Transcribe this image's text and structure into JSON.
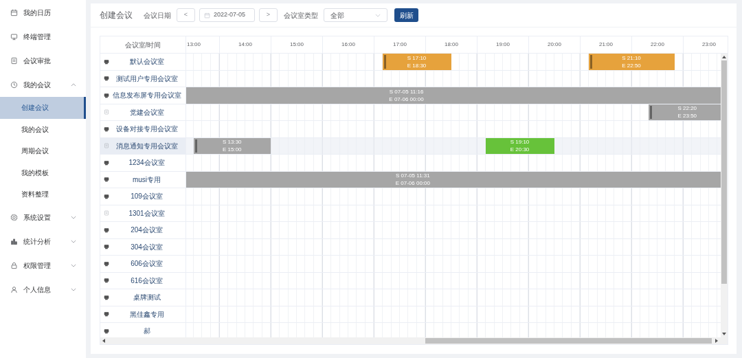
{
  "sidebar": {
    "items": [
      {
        "label": "我的日历",
        "selected": false
      },
      {
        "label": "终端管理",
        "selected": false
      },
      {
        "label": "会议审批",
        "selected": false
      },
      {
        "label": "我的会议",
        "selected": false,
        "expanded": true,
        "children": [
          {
            "label": "创建会议",
            "selected": true
          },
          {
            "label": "我的会议",
            "selected": false
          },
          {
            "label": "周期会议",
            "selected": false
          },
          {
            "label": "我的模板",
            "selected": false
          },
          {
            "label": "资料整理",
            "selected": false
          }
        ]
      },
      {
        "label": "系统设置",
        "selected": false,
        "expanded": false
      },
      {
        "label": "统计分析",
        "selected": false,
        "expanded": false
      },
      {
        "label": "权限管理",
        "selected": false,
        "expanded": false
      },
      {
        "label": "个人信息",
        "selected": false,
        "expanded": false
      }
    ]
  },
  "toolbar": {
    "title": "创建会议",
    "date_label": "会议日期",
    "prev": "<",
    "date": "2022-07-05",
    "next": ">",
    "type_label": "会议室类型",
    "type_value": "全部",
    "refresh": "刷新"
  },
  "table": {
    "corner": "会议室/时间",
    "hours": [
      "13:00",
      "14:00",
      "15:00",
      "16:00",
      "17:00",
      "18:00",
      "19:00",
      "20:00",
      "21:00",
      "22:00",
      "23:00"
    ],
    "rows": [
      {
        "room": "默认会议室",
        "kind": "monitor",
        "highlighted": false,
        "events": [
          {
            "color": "#e6a23c",
            "marker": true,
            "lines": [
              "S 17:10",
              "E 18:30"
            ]
          },
          {
            "color": "#e6a23c",
            "marker": true,
            "lines": [
              "S 21:10",
              "E 22:50"
            ]
          }
        ]
      },
      {
        "room": "测试用户专用会议室",
        "kind": "monitor",
        "highlighted": false
      },
      {
        "room": "信息发布屏专用会议室",
        "kind": "monitor",
        "highlighted": false,
        "events": [
          {
            "color": "#a6a6a6",
            "marker": false,
            "lines": [
              "S 07-05 11:16",
              "E 07-06 00:00"
            ]
          }
        ]
      },
      {
        "room": "党建会议室",
        "kind": "document",
        "highlighted": false,
        "events": [
          {
            "color": "#a6a6a6",
            "marker": true,
            "lines": [
              "S 22:20",
              "E 23:50"
            ]
          }
        ]
      },
      {
        "room": "设备对接专用会议室",
        "kind": "monitor",
        "highlighted": false
      },
      {
        "room": "消息通知专用会议室",
        "kind": "document",
        "highlighted": true,
        "events": [
          {
            "color": "#a6a6a6",
            "marker": true,
            "lines": [
              "S 13:30",
              "E 15:00"
            ]
          },
          {
            "color": "#67c23a",
            "marker": false,
            "lines": [
              "S 19:10",
              "E 20:30"
            ]
          }
        ]
      },
      {
        "room": "1234会议室",
        "kind": "monitor",
        "highlighted": false
      },
      {
        "room": "musi专用",
        "kind": "monitor",
        "highlighted": false,
        "events": [
          {
            "color": "#a6a6a6",
            "marker": false,
            "lines": [
              "S 07-05 11:31",
              "E 07-06 00:00"
            ]
          }
        ]
      },
      {
        "room": "109会议室",
        "kind": "monitor",
        "highlighted": false
      },
      {
        "room": "1301会议室",
        "kind": "document",
        "highlighted": false
      },
      {
        "room": "204会议室",
        "kind": "monitor",
        "highlighted": false
      },
      {
        "room": "304会议室",
        "kind": "monitor",
        "highlighted": false
      },
      {
        "room": "606会议室",
        "kind": "monitor",
        "highlighted": false
      },
      {
        "room": "616会议室",
        "kind": "monitor",
        "highlighted": false
      },
      {
        "room": "桌牌测试",
        "kind": "monitor",
        "highlighted": false
      },
      {
        "room": "黑佳鑫专用",
        "kind": "monitor",
        "highlighted": false
      },
      {
        "room": "郝",
        "kind": "monitor",
        "highlighted": false
      }
    ]
  }
}
